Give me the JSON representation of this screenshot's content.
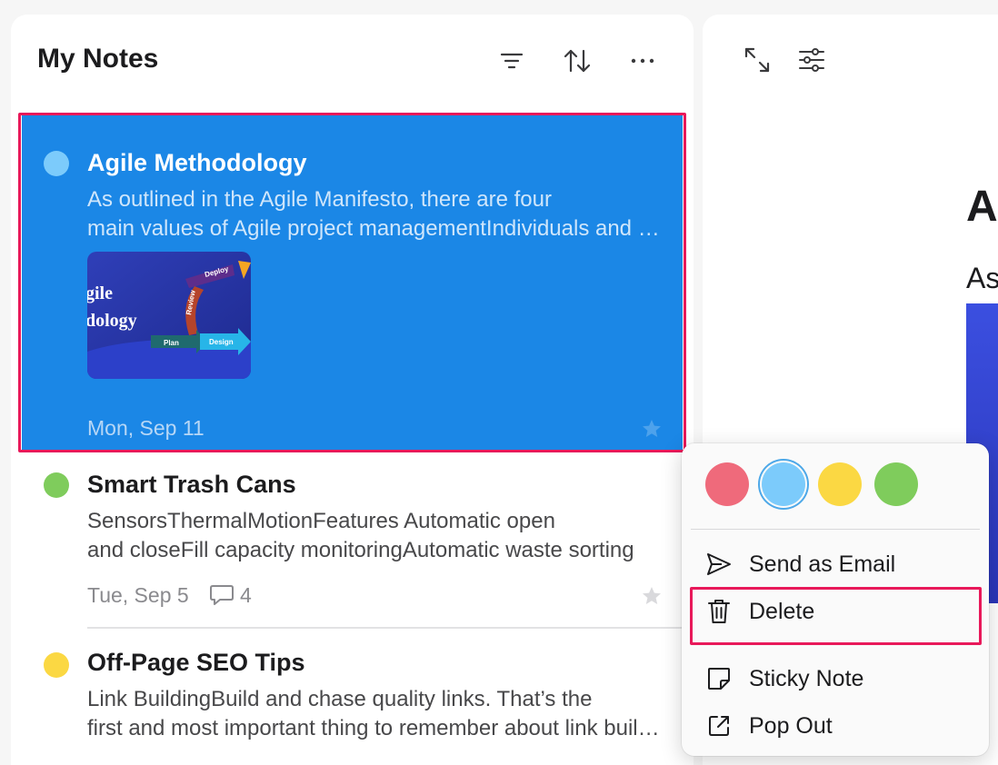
{
  "list": {
    "title": "My Notes",
    "header_icons": [
      "filter-icon",
      "sort-icon",
      "more-icon"
    ]
  },
  "notes": [
    {
      "title": "Agile Methodology",
      "excerpt_line1": "As outlined in the Agile Manifesto, there are four",
      "excerpt_line2": "main values of Agile project managementIndividuals and interactions",
      "date": "Mon, Sep 11",
      "color": "#7ccbfb",
      "selected": true,
      "thumbnail": {
        "title_line1": "gile",
        "title_line2": "dology",
        "labels": [
          "Deploy",
          "Review",
          "Plan",
          "Design"
        ]
      }
    },
    {
      "title": "Smart Trash Cans",
      "excerpt_line1": "SensorsThermalMotionFeatures Automatic open",
      "excerpt_line2": "and closeFill capacity monitoringAutomatic waste sorting",
      "date": "Tue, Sep 5",
      "comments": "4",
      "color": "#7fcc5c"
    },
    {
      "title": "Off-Page SEO Tips",
      "excerpt_line1": "Link BuildingBuild and chase quality links. That’s the",
      "excerpt_line2": "first and most important thing to remember about link building",
      "color": "#fbd843"
    }
  ],
  "detail": {
    "title": "Ag",
    "subtitle": "As"
  },
  "menu": {
    "colors": [
      "#ef6a7b",
      "#7ccbfb",
      "#fbd843",
      "#7fcc5c"
    ],
    "items": [
      {
        "label": "Send as Email",
        "icon": "send-icon"
      },
      {
        "label": "Delete",
        "icon": "trash-icon"
      },
      {
        "label": "Sticky Note",
        "icon": "sticky-note-icon"
      },
      {
        "label": "Pop Out",
        "icon": "pop-out-icon"
      }
    ]
  }
}
